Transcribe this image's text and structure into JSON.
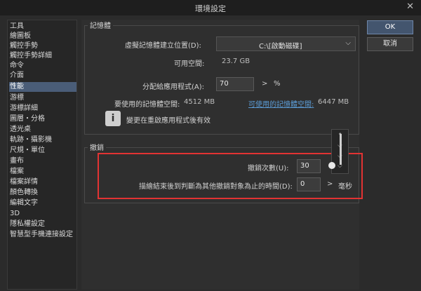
{
  "window": {
    "title": "環境設定",
    "close_glyph": "✕"
  },
  "sidebar": {
    "items": [
      {
        "label": "工具"
      },
      {
        "label": "繪圖板"
      },
      {
        "label": "觸控手勢"
      },
      {
        "label": "觸控手勢詳細"
      },
      {
        "label": "命令"
      },
      {
        "label": "介面"
      },
      {
        "label": "性能",
        "active": true
      },
      {
        "label": "游標"
      },
      {
        "label": "游標詳細"
      },
      {
        "label": "圖層・分格"
      },
      {
        "label": "透光桌"
      },
      {
        "label": "軌跡・攝影機"
      },
      {
        "label": "尺規・單位"
      },
      {
        "label": "畫布"
      },
      {
        "label": "檔案"
      },
      {
        "label": "檔案詳情"
      },
      {
        "label": "顏色轉換"
      },
      {
        "label": "編輯文字"
      },
      {
        "label": "3D"
      },
      {
        "label": "隱私權設定"
      },
      {
        "label": "智慧型手機連接設定"
      }
    ]
  },
  "memory": {
    "title": "記憶體",
    "vm_location_label": "虛擬記憶體建立位置(D):",
    "vm_location_value": "C:\\[啟動磁碟]",
    "free_space_label": "可用空間:",
    "free_space_value": "23.7 GB",
    "alloc_label": "分配給應用程式(A):",
    "alloc_value": "70",
    "alloc_unit": "%",
    "used_label": "要使用的記憶體空間:",
    "used_value": "4512 MB",
    "available_link": "可使用的記憶體空間:",
    "available_value": "6447 MB",
    "info_text": "變更在重啟應用程式後有效",
    "info_icon_glyph": "i"
  },
  "undo": {
    "title": "撤銷",
    "count_label": "撤銷次數(U):",
    "count_value": "30",
    "time_label": "描繪結束後到判斷為其他撤銷對象為止的時間(D):",
    "time_value": "0",
    "time_unit": "毫秒",
    "slider_level": 0.0
  },
  "glyphs": {
    "arrow": ">",
    "chevron_down": "⌵",
    "chevron_up": "⌃"
  },
  "buttons": {
    "ok": "OK",
    "cancel": "取消"
  },
  "highlight_color": "#e23333",
  "accent_color": "#4a5d78"
}
